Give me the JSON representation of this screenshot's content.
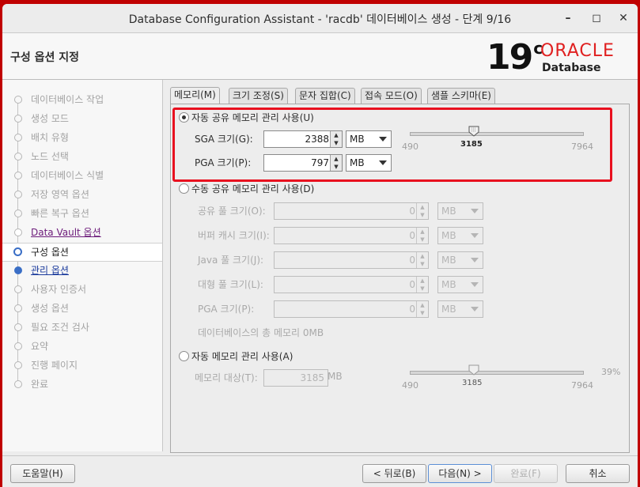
{
  "window": {
    "title": "Database Configuration Assistant - 'racdb' 데이터베이스 생성 - 단계 9/16",
    "minimize": "–",
    "maximize": "◻",
    "close": "✕"
  },
  "header": {
    "page_title": "구성 옵션 지정",
    "logo_version": "19",
    "logo_sup": "c",
    "logo_brand": "ORACLE",
    "logo_product": "Database"
  },
  "sidebar": {
    "items": [
      {
        "label": "데이터베이스 작업",
        "state": "disabled"
      },
      {
        "label": "생성 모드",
        "state": "disabled"
      },
      {
        "label": "배치 유형",
        "state": "disabled"
      },
      {
        "label": "노드 선택",
        "state": "disabled"
      },
      {
        "label": "데이터베이스 식별",
        "state": "disabled"
      },
      {
        "label": "저장 영역 옵션",
        "state": "disabled"
      },
      {
        "label": "빠른 복구 옵션",
        "state": "disabled"
      },
      {
        "label": "Data Vault 옵션",
        "state": "visited"
      },
      {
        "label": "구성 옵션",
        "state": "current"
      },
      {
        "label": "관리 옵션",
        "state": "link"
      },
      {
        "label": "사용자 인증서",
        "state": "disabled"
      },
      {
        "label": "생성 옵션",
        "state": "disabled"
      },
      {
        "label": "필요 조건 검사",
        "state": "disabled"
      },
      {
        "label": "요약",
        "state": "disabled"
      },
      {
        "label": "진행 페이지",
        "state": "disabled"
      },
      {
        "label": "완료",
        "state": "disabled"
      }
    ]
  },
  "tabs": [
    {
      "label": "메모리(M)",
      "active": true
    },
    {
      "label": "크기 조정(S)",
      "active": false
    },
    {
      "label": "문자 집합(C)",
      "active": false
    },
    {
      "label": "접속 모드(O)",
      "active": false
    },
    {
      "label": "샘플 스키마(E)",
      "active": false
    }
  ],
  "memory": {
    "auto_shared": {
      "label": "자동 공유 메모리 관리 사용(U)",
      "selected": true,
      "sga_label": "SGA 크기(G):",
      "sga_value": "2388",
      "sga_unit": "MB",
      "pga_label": "PGA 크기(P):",
      "pga_value": "797",
      "pga_unit": "MB",
      "slider_min": "490",
      "slider_max": "7964",
      "slider_value": "3185"
    },
    "manual_shared": {
      "label": "수동 공유 메모리 관리 사용(D)",
      "selected": false,
      "fields": [
        {
          "label": "공유 풀 크기(O):",
          "value": "0",
          "unit": "MB"
        },
        {
          "label": "버퍼 캐시 크기(I):",
          "value": "0",
          "unit": "MB"
        },
        {
          "label": "Java 풀 크기(J):",
          "value": "0",
          "unit": "MB"
        },
        {
          "label": "대형 풀 크기(L):",
          "value": "0",
          "unit": "MB"
        },
        {
          "label": "PGA 크기(P):",
          "value": "0",
          "unit": "MB"
        }
      ],
      "total_label": "데이터베이스의 총 메모리 0MB"
    },
    "auto_memory": {
      "label": "자동 메모리 관리 사용(A)",
      "selected": false,
      "target_label": "메모리 대상(T):",
      "target_value": "3185",
      "target_unit": "MB",
      "percent": "39%",
      "slider_min": "490",
      "slider_max": "7964",
      "slider_value": "3185"
    }
  },
  "buttons": {
    "help": "도움말(H)",
    "back": "< 뒤로(B)",
    "next": "다음(N) >",
    "finish": "완료(F)",
    "cancel": "취소"
  },
  "colors": {
    "highlight_box": "#e8101f",
    "oracle_red": "#e02020",
    "link_purple": "#6c1b7a",
    "link_blue": "#1a3a9c"
  }
}
